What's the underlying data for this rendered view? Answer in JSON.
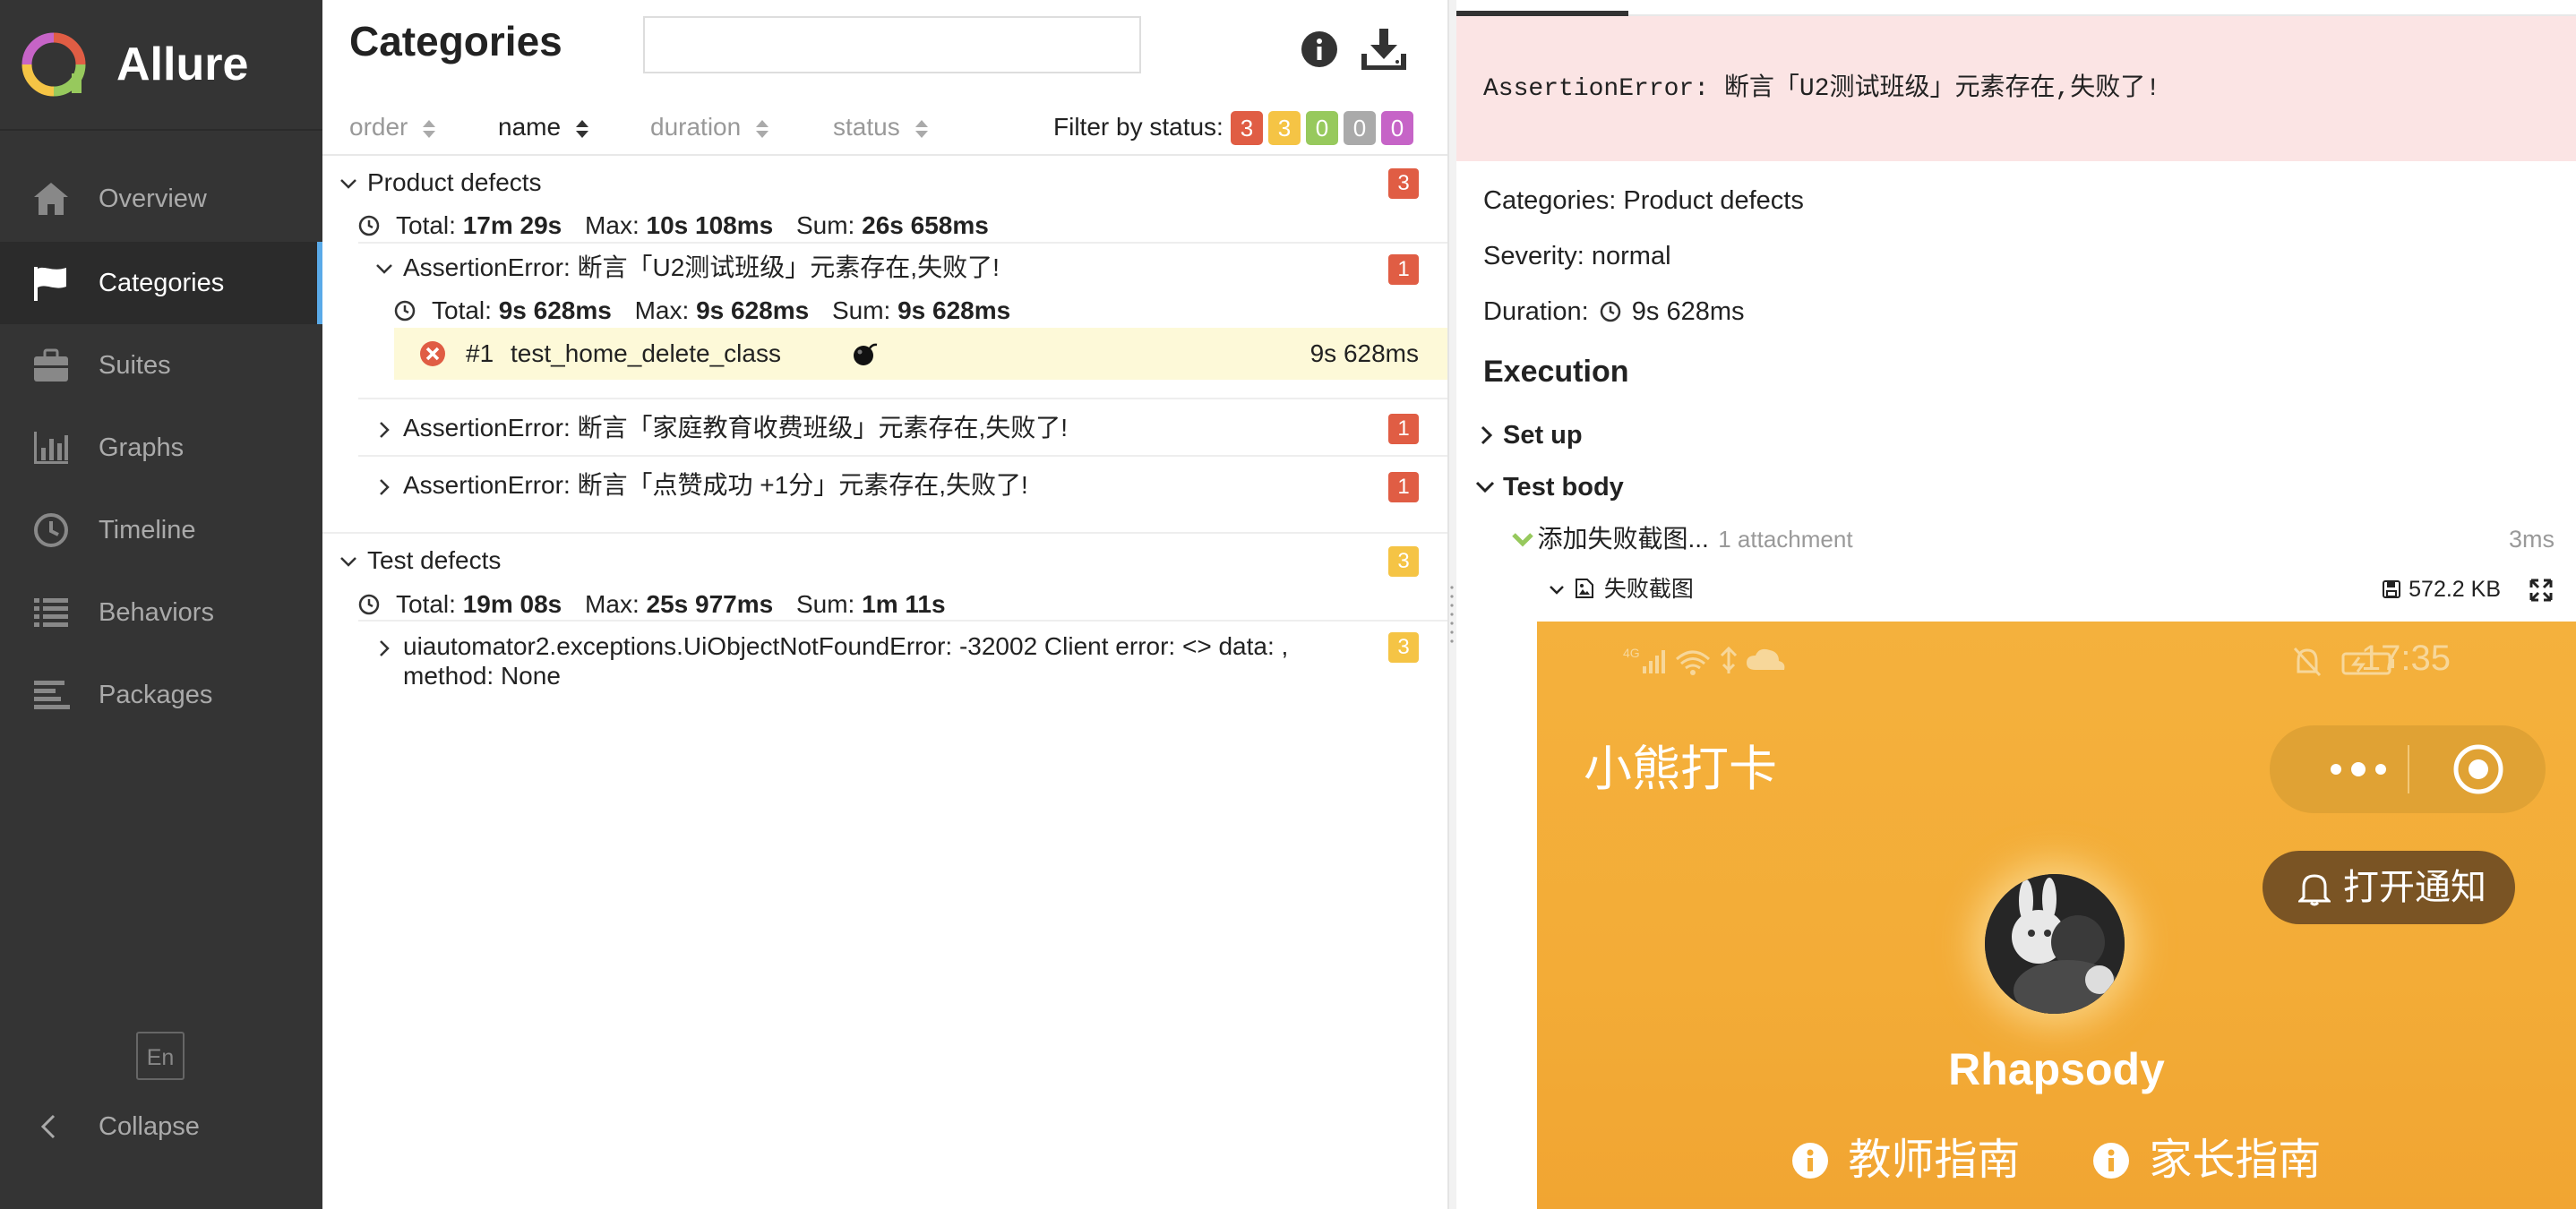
{
  "app": {
    "name": "Allure"
  },
  "sidebar": {
    "items": [
      {
        "label": "Overview",
        "icon": "home-icon"
      },
      {
        "label": "Categories",
        "icon": "flag-icon",
        "active": true
      },
      {
        "label": "Suites",
        "icon": "briefcase-icon"
      },
      {
        "label": "Graphs",
        "icon": "bar-chart-icon"
      },
      {
        "label": "Timeline",
        "icon": "clock-icon"
      },
      {
        "label": "Behaviors",
        "icon": "list-icon"
      },
      {
        "label": "Packages",
        "icon": "align-left-icon"
      }
    ],
    "language": "En",
    "collapse_label": "Collapse"
  },
  "categories": {
    "title": "Categories",
    "search_placeholder": "",
    "sort_columns": [
      "order",
      "name",
      "duration",
      "status"
    ],
    "active_sort": "name",
    "filter_label": "Filter by status:",
    "filter_counts": [
      {
        "count": "3",
        "color": "#e05d44"
      },
      {
        "count": "3",
        "color": "#f5c445"
      },
      {
        "count": "0",
        "color": "#97c95d"
      },
      {
        "count": "0",
        "color": "#aaaaaa"
      },
      {
        "count": "0",
        "color": "#c664c7"
      }
    ],
    "groups": [
      {
        "name": "Product defects",
        "count": "3",
        "stats": {
          "total_label": "Total:",
          "total": "17m 29s",
          "max_label": "Max:",
          "max": "10s 108ms",
          "sum_label": "Sum:",
          "sum": "26s 658ms"
        },
        "children": [
          {
            "name": "AssertionError: 断言「U2测试班级」元素存在,失败了!",
            "count": "1",
            "stats": {
              "total_label": "Total:",
              "total": "9s 628ms",
              "max_label": "Max:",
              "max": "9s 628ms",
              "sum_label": "Sum:",
              "sum": "9s 628ms"
            },
            "tests": [
              {
                "index": "#1",
                "name": "test_home_delete_class",
                "duration": "9s 628ms"
              }
            ]
          },
          {
            "name": "AssertionError: 断言「家庭教育收费班级」元素存在,失败了!",
            "count": "1"
          },
          {
            "name": "AssertionError: 断言「点赞成功 +1分」元素存在,失败了!",
            "count": "1"
          }
        ]
      },
      {
        "name": "Test defects",
        "count": "3",
        "stats": {
          "total_label": "Total:",
          "total": "19m 08s",
          "max_label": "Max:",
          "max": "25s 977ms",
          "sum_label": "Sum:",
          "sum": "1m 11s"
        },
        "children": [
          {
            "name_line1": "uiautomator2.exceptions.UiObjectNotFoundError: -32002 Client error: <> data: ,",
            "name_line2": "method: None",
            "count": "3"
          }
        ]
      }
    ]
  },
  "details": {
    "error_message": "AssertionError: 断言「U2测试班级」元素存在,失败了!",
    "categories_line": "Categories: Product defects",
    "severity_line": "Severity: normal",
    "duration_label": "Duration:",
    "duration": "9s 628ms",
    "execution_title": "Execution",
    "setup_label": "Set up",
    "test_body_label": "Test body",
    "step_name": "添加失败截图...",
    "attachment_count": "1 attachment",
    "step_duration": "3ms",
    "attachment_name": "失败截图",
    "attachment_size": "572.2 KB"
  },
  "screenshot": {
    "status_time": "17:35",
    "mini_program_title": "小熊打卡",
    "notify_button": "打开通知",
    "username": "Rhapsody",
    "guide_teacher": "教师指南",
    "guide_parent": "家长指南"
  },
  "colors": {
    "sidebar_bg": "#343434",
    "accent": "#5aaae8",
    "failed": "#e05d44",
    "broken": "#f5c445",
    "error_bg": "#fbe4e4",
    "highlight_row": "#fdf9d8",
    "screenshot_bg": "#f3ae39"
  }
}
